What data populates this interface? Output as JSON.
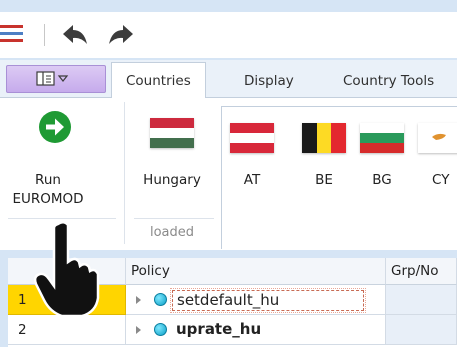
{
  "tabs": [
    {
      "label": "Countries",
      "active": true
    },
    {
      "label": "Display",
      "active": false
    },
    {
      "label": "Country Tools",
      "active": false
    }
  ],
  "ribbon": {
    "run_button": {
      "line1": "Run",
      "line2": "EUROMOD"
    },
    "loaded_country": {
      "label": "Hungary",
      "caption": "loaded"
    },
    "countries": [
      {
        "code": "AT"
      },
      {
        "code": "BE"
      },
      {
        "code": "BG"
      },
      {
        "code": "CY"
      }
    ]
  },
  "grid": {
    "headers": {
      "policy": "Policy",
      "grpno": "Grp/No"
    },
    "rows": [
      {
        "num": "1",
        "policy": "setdefault_hu",
        "selected": true
      },
      {
        "num": "2",
        "policy": "uprate_hu",
        "selected": false
      }
    ]
  },
  "colors": {
    "accent": "#0078d4",
    "selected_row": "#ffd500",
    "run_green": "#1f9a34",
    "window_bg": "#d6e5f5"
  }
}
